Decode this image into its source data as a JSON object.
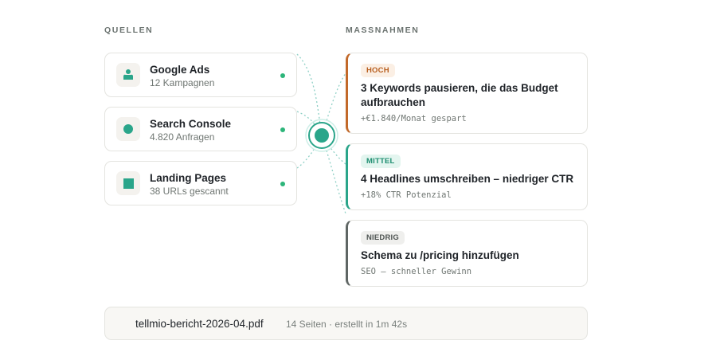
{
  "sections": {
    "sources_label": "QUELLEN",
    "actions_label": "MASSNAHMEN"
  },
  "sources": [
    {
      "title": "Google Ads",
      "subtitle": "12 Kampagnen",
      "icon": "ads-icon",
      "status": "connected"
    },
    {
      "title": "Search Console",
      "subtitle": "4.820 Anfragen",
      "icon": "search-console-icon",
      "status": "connected"
    },
    {
      "title": "Landing Pages",
      "subtitle": "38 URLs gescannt",
      "icon": "landing-pages-icon",
      "status": "connected"
    }
  ],
  "actions": [
    {
      "badge": "HOCH",
      "title": "3 Keywords pausieren, die das Budget aufbrauchen",
      "detail": "+€1.840/Monat gespart",
      "accent": "#c2692a"
    },
    {
      "badge": "MITTEL",
      "title": "4 Headlines umschreiben – niedriger CTR",
      "detail": "+18% CTR Potenzial",
      "accent": "#2aa58a"
    },
    {
      "badge": "NIEDRIG",
      "title": "Schema zu /pricing hinzufügen",
      "detail": "SEO – schneller Gewinn",
      "accent": "#5f6664"
    }
  ],
  "footer": {
    "filename": "tellmio-bericht-2026-04.pdf",
    "meta": "14 Seiten · erstellt in 1m 42s"
  },
  "colors": {
    "accent_teal": "#2aa58a",
    "status_green": "#2db57a",
    "high": "#c2692a",
    "medium": "#2aa58a",
    "low": "#5f6664"
  }
}
